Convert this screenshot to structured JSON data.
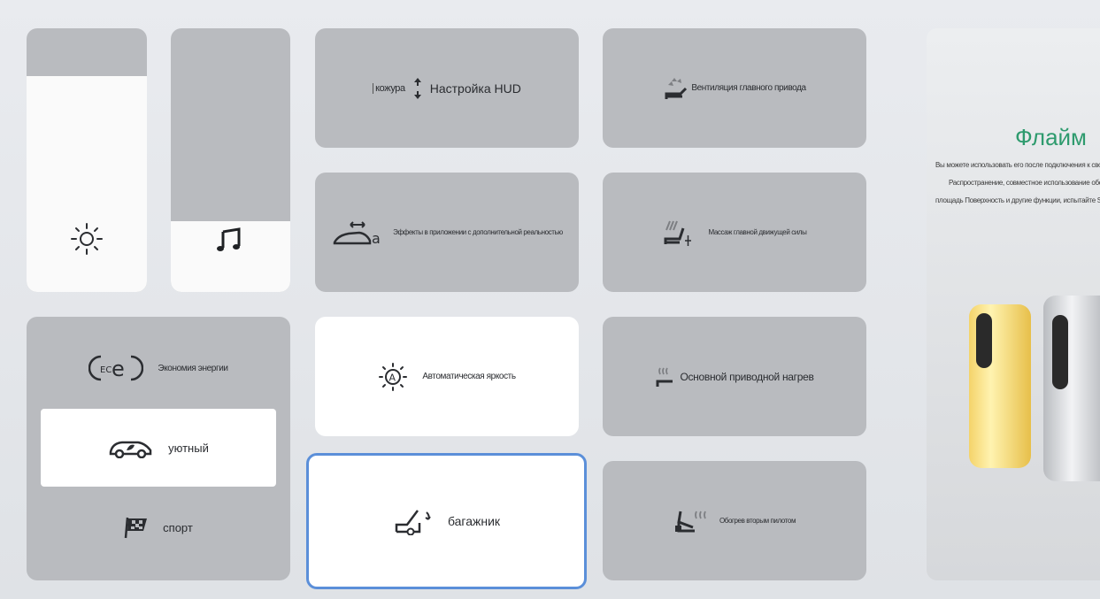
{
  "sliders": {
    "brightness": {
      "icon": "sun-icon",
      "level": 0.82
    },
    "volume": {
      "icon": "music-note-icon",
      "level": 0.27
    }
  },
  "drive_modes": {
    "eco_label": "Экономия энергии",
    "comfort_label": "уютный",
    "sport_label": "спорт",
    "active": "comfort"
  },
  "controls": {
    "hud": {
      "prefix": "кожура",
      "label": "Настройка HUD"
    },
    "vent": {
      "label": "Вентиляция главного привода"
    },
    "ar": {
      "label": "Эффекты в приложении с дополнительной реальностью"
    },
    "massage": {
      "label": "Массаж главной движущей силы"
    },
    "auto_bright": {
      "label": "Автоматическая яркость"
    },
    "heat": {
      "label": "Основной приводной нагрев"
    },
    "trunk": {
      "label": "багажник"
    },
    "rear_heat": {
      "label": "Обогрев вторым пилотом"
    }
  },
  "promo": {
    "title": "Флайм",
    "lines": [
      "Вы можете использовать его после подключения к своему телефону",
      "Распространение, совместное использование оборудования",
      "площадь Поверхность и другие функции, испытайте Sharp"
    ]
  },
  "colors": {
    "accent": "#5b8fd9",
    "brand": "#2e9b6e",
    "tile": "#b9bbbf"
  }
}
